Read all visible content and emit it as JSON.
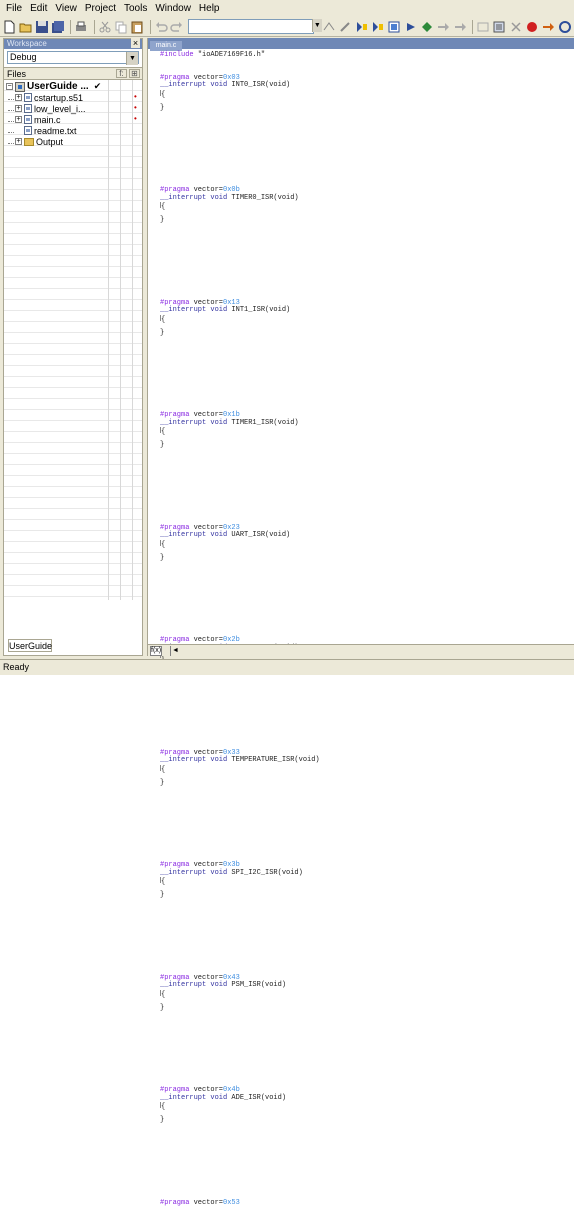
{
  "menu": [
    "File",
    "Edit",
    "View",
    "Project",
    "Tools",
    "Window",
    "Help"
  ],
  "toolbar": {
    "icons": [
      "new-file-icon",
      "open-icon",
      "save-icon",
      "save-all-icon",
      "print-icon",
      "cut-icon",
      "copy-icon",
      "paste-icon",
      "undo-icon",
      "redo-icon",
      "find-icon",
      "toggle-bookmark-icon",
      "next-bookmark-icon",
      "prev-bookmark-icon",
      "make-icon",
      "debug-icon",
      "go-icon",
      "step-icon",
      "breakpoint-icon",
      "stop-icon"
    ],
    "find_combo_value": "",
    "second_combo_value": ""
  },
  "workspace": {
    "title": "Workspace",
    "config": "Debug",
    "files_header": "Files",
    "files_icons": [
      "f:",
      "⊞"
    ],
    "tree": [
      {
        "label": "UserGuide ...",
        "kind": "project",
        "level": 0,
        "expanded": true,
        "check": "✔"
      },
      {
        "label": "cstartup.s51",
        "kind": "file",
        "level": 1,
        "expanded": false,
        "dot": "•"
      },
      {
        "label": "low_level_i...",
        "kind": "file",
        "level": 1,
        "expanded": false,
        "dot": "•"
      },
      {
        "label": "main.c",
        "kind": "file",
        "level": 1,
        "expanded": false,
        "dot": "•"
      },
      {
        "label": "readme.txt",
        "kind": "file",
        "level": 1,
        "expanded": null
      },
      {
        "label": "Output",
        "kind": "folder",
        "level": 1,
        "expanded": false
      }
    ],
    "bottom_tab": "UserGuide"
  },
  "editor": {
    "tab": "main.c",
    "include_line": "#include \"ioADE7169F16.h\"",
    "handlers": [
      {
        "vector": "0x03",
        "name": "INT0_ISR"
      },
      {
        "vector": "0x0b",
        "name": "TIMER0_ISR"
      },
      {
        "vector": "0x13",
        "name": "INT1_ISR"
      },
      {
        "vector": "0x1b",
        "name": "TIMER1_ISR"
      },
      {
        "vector": "0x23",
        "name": "UART_ISR"
      },
      {
        "vector": "0x2b",
        "name": "TIMER2_ISR"
      },
      {
        "vector": "0x33",
        "name": "TEMPERATURE_ISR"
      },
      {
        "vector": "0x3b",
        "name": "SPI_I2C_ISR"
      },
      {
        "vector": "0x43",
        "name": "PSM_ISR"
      },
      {
        "vector": "0x4b",
        "name": "ADE_ISR"
      },
      {
        "vector": "0x53",
        "name": ""
      }
    ],
    "pragma_keyword": "#pragma",
    "vector_prefix": "vector=",
    "interrupt_prefix": "__interrupt void ",
    "interrupt_suffix": "(void)",
    "scroll_tab": "f(x)"
  },
  "status": {
    "text": "Ready"
  },
  "colors": {
    "window_bg": "#ece9d8",
    "panel_title": "#6f88b6",
    "keyword": "#3232a0",
    "preprocessor": "#8a2be2",
    "number": "#3c8ce0"
  }
}
